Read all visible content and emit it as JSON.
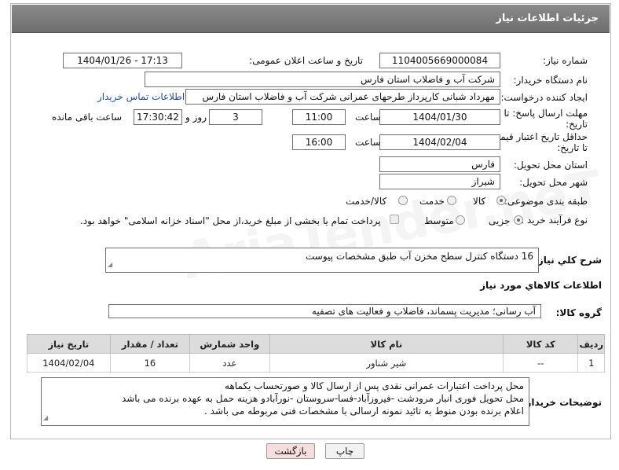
{
  "header": {
    "title": "جزئیات اطلاعات نیاز"
  },
  "labels": {
    "need_number": "شماره نیاز:",
    "announce_datetime": "تاریخ و ساعت اعلان عمومی:",
    "buyer_org": "نام دستگاه خریدار:",
    "requester": "ایجاد کننده درخواست:",
    "deadline_line1": "مهلت ارسال پاسخ: تا",
    "deadline_line2": "تاریخ:",
    "min_validity_line1": "حداقل تاریخ اعتبار قیمت:",
    "min_validity_line2": "تا تاریخ:",
    "hour": "ساعت",
    "day_and": "روز و",
    "remaining": "ساعت باقی مانده",
    "province": "استان محل تحویل:",
    "city": "شهر محل تحویل:",
    "category": "طبقه بندی موضوعی:",
    "process_type": "نوع فرآیند خرید :",
    "description": "شرح كلي نياز:",
    "goods_info": "اطلاعات كالاهاي مورد نياز",
    "goods_group": "گروه كالا:",
    "buyer_notes": "توضیحات خریدار:"
  },
  "fields": {
    "need_number": "1104005669000084",
    "announce_datetime": "1404/01/26 - 17:13",
    "buyer_org": "شرکت آب و فاضلاب استان فارس",
    "requester": "مهرداد شبانی کارپرداز طرحهای عمرانی  شرکت آب و فاضلاب استان فارس",
    "contact_link": "اطلاعات تماس خریدار",
    "deadline_date": "1404/01/30",
    "deadline_time": "11:00",
    "deadline_days": "3",
    "remaining_time": "17:30:42",
    "validity_date": "1404/02/04",
    "validity_time": "16:00",
    "province": "فارس",
    "city": "شیراز",
    "description": "16 دستگاه کنترل سطح مخزن آب طبق مشخصات پیوست",
    "goods_group": "آب رسانی؛ مدیریت پسماند، فاضلاب و فعالیت های تصفیه"
  },
  "category_options": [
    "کالا",
    "خدمت",
    "کالا/خدمت"
  ],
  "category_selected": "کالا",
  "process_options": [
    "جزیی",
    "متوسط"
  ],
  "process_selected": "جزیی",
  "payment_note": "پرداخت تمام یا بخشی از مبلغ خرید،از محل \"اسناد خزانه اسلامی\" خواهد بود.",
  "table": {
    "headers": [
      "ردیف",
      "کد کالا",
      "نام کالا",
      "واحد شمارش",
      "تعداد / مقدار",
      "تاریخ نیاز"
    ],
    "rows": [
      [
        "1",
        "--",
        "شیر شناور",
        "عدد",
        "16",
        "1404/02/04"
      ]
    ]
  },
  "buyer_notes": [
    "محل پرداخت اعتبارات عمرانی نقدی پس از ارسال کالا و صورتحساب یکماهه",
    "محل تحویل فوری انبار مرودشت -فیروزآباد-فسا-سروستان -نورآبادو هزینه حمل به عهده برنده می باشد",
    "اعلام برنده بودن منوط به تائید نمونه ارسالی با مشخصات فنی مربوطه می باشد ."
  ],
  "buttons": {
    "print": "چاپ",
    "back": "بازگشت"
  },
  "watermark": "AriaTender.neT",
  "colors": {
    "title_bar": "#7a7a7a",
    "link": "#1a4f9c",
    "back_button": "#f6dede"
  }
}
